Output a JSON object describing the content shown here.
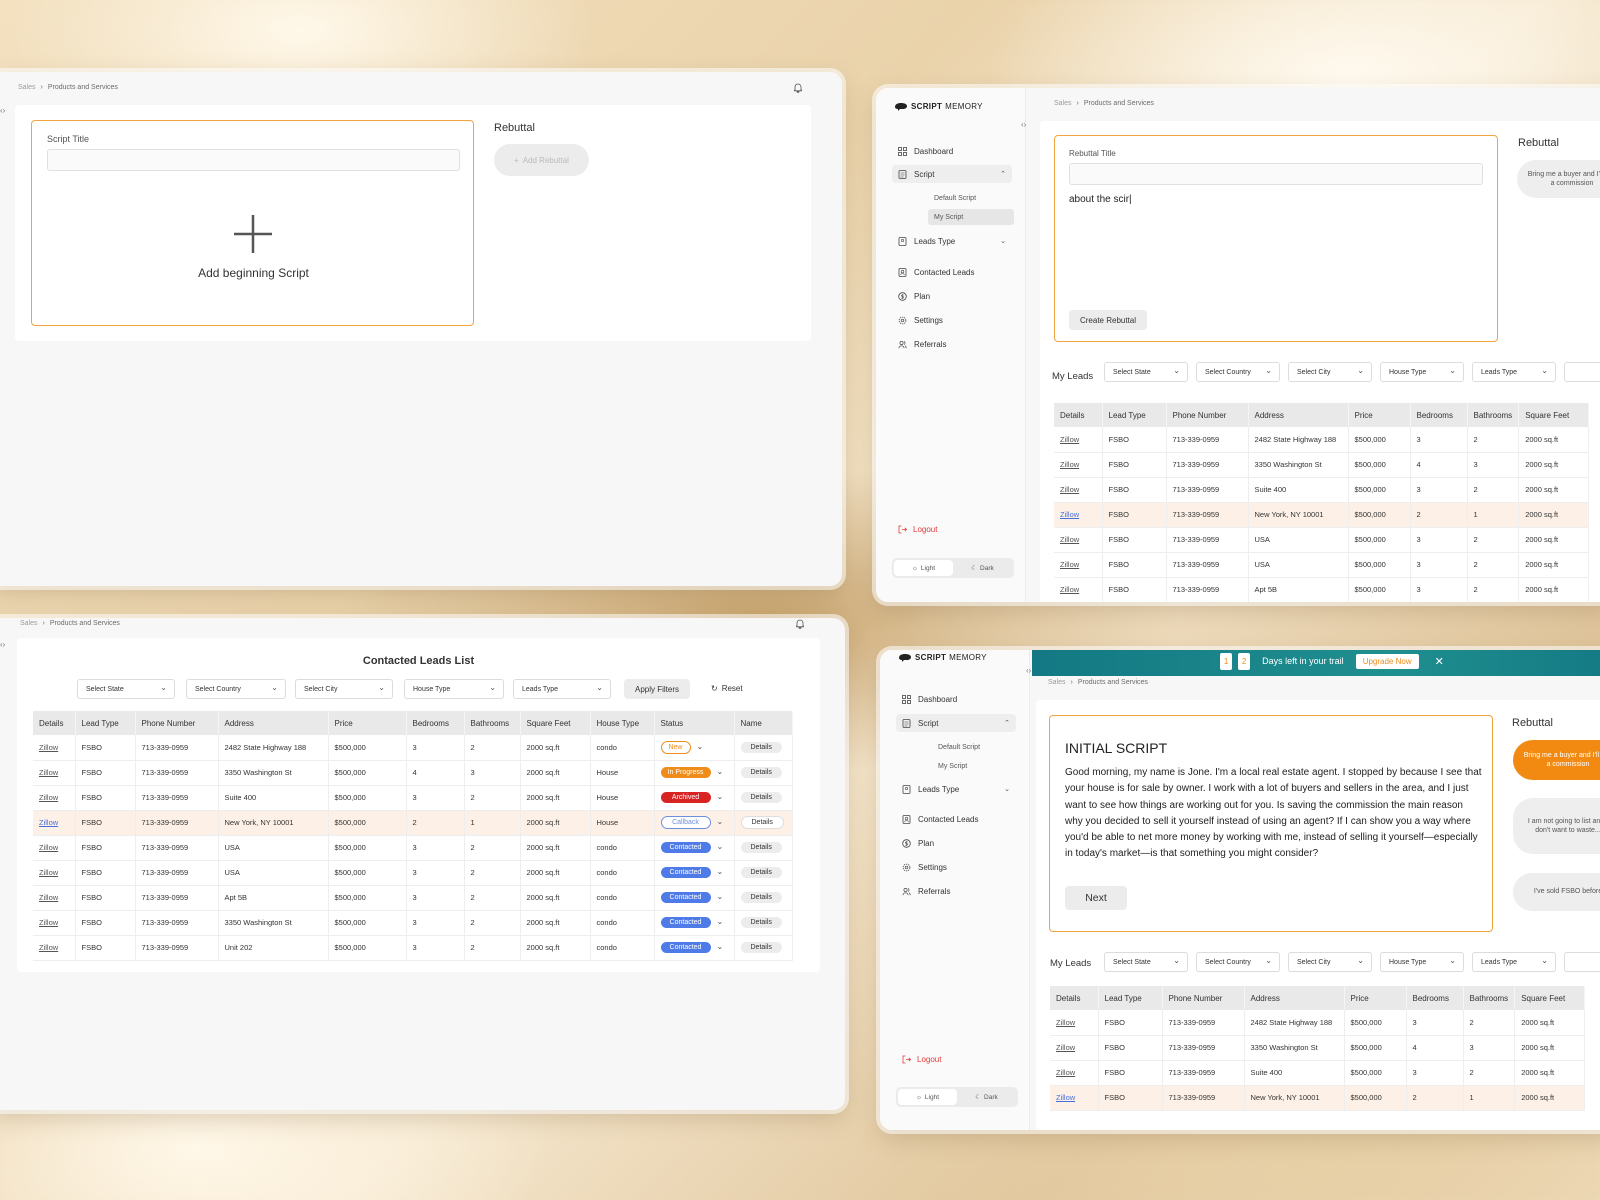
{
  "common": {
    "breadcrumb_root": "Sales",
    "breadcrumb_leaf": "Products and Services",
    "logo_bold": "SCRIPT",
    "logo_light": "MEMORY",
    "rebuttal_heading": "Rebuttal",
    "nav": {
      "dashboard": "Dashboard",
      "script": "Script",
      "default_script": "Default Script",
      "my_script": "My Script",
      "leads_type": "Leads Type",
      "contacted_leads": "Contacted Leads",
      "plan": "Plan",
      "settings": "Settings",
      "referrals": "Referrals",
      "logout": "Logout"
    },
    "theme_light": "Light",
    "theme_dark": "Dark",
    "filters": {
      "state": "Select State",
      "country": "Select Country",
      "city": "Select City",
      "house": "House Type",
      "leads": "Leads Type"
    },
    "my_leads": "My Leads"
  },
  "window1": {
    "script_title_label": "Script Title",
    "script_title_value": "",
    "add_rebuttal": "Add Rebuttal",
    "add_beginning": "Add beginning Script"
  },
  "window2": {
    "rebuttal_title_label": "Rebuttal Title",
    "rebuttal_title_value": "",
    "rebuttal_body": "about  the scir|",
    "create_rebuttal": "Create Rebuttal",
    "bubble1": "Bring me a buyer and I'll pay a commission",
    "columns": [
      "Details",
      "Lead Type",
      "Phone Number",
      "Address",
      "Price",
      "Bedrooms",
      "Bathrooms",
      "Square Feet"
    ],
    "rows": [
      [
        "Zillow",
        "FSBO",
        "713-339-0959",
        "2482 State Highway 188",
        "$500,000",
        "3",
        "2",
        "2000 sq.ft"
      ],
      [
        "Zillow",
        "FSBO",
        "713-339-0959",
        "3350 Washington St",
        "$500,000",
        "4",
        "3",
        "2000 sq.ft"
      ],
      [
        "Zillow",
        "FSBO",
        "713-339-0959",
        "Suite 400",
        "$500,000",
        "3",
        "2",
        "2000 sq.ft"
      ],
      [
        "Zillow",
        "FSBO",
        "713-339-0959",
        "New York, NY 10001",
        "$500,000",
        "2",
        "1",
        "2000 sq.ft"
      ],
      [
        "Zillow",
        "FSBO",
        "713-339-0959",
        "USA",
        "$500,000",
        "3",
        "2",
        "2000 sq.ft"
      ],
      [
        "Zillow",
        "FSBO",
        "713-339-0959",
        "USA",
        "$500,000",
        "3",
        "2",
        "2000 sq.ft"
      ],
      [
        "Zillow",
        "FSBO",
        "713-339-0959",
        "Apt 5B",
        "$500,000",
        "3",
        "2",
        "2000 sq.ft"
      ]
    ]
  },
  "window3": {
    "title": "Contacted Leads List",
    "apply_filters": "Apply Filters",
    "reset": "Reset",
    "columns": [
      "Details",
      "Lead Type",
      "Phone Number",
      "Address",
      "Price",
      "Bedrooms",
      "Bathrooms",
      "Square Feet",
      "House Type",
      "Status",
      "Name"
    ],
    "rows": [
      [
        "Zillow",
        "FSBO",
        "713-339-0959",
        "2482 State Highway 188",
        "$500,000",
        "3",
        "2",
        "2000 sq.ft",
        "condo",
        "New",
        "Details"
      ],
      [
        "Zillow",
        "FSBO",
        "713-339-0959",
        "3350 Washington St",
        "$500,000",
        "4",
        "3",
        "2000 sq.ft",
        "House",
        "In Progress",
        "Details"
      ],
      [
        "Zillow",
        "FSBO",
        "713-339-0959",
        "Suite 400",
        "$500,000",
        "3",
        "2",
        "2000 sq.ft",
        "House",
        "Archived",
        "Details"
      ],
      [
        "Zillow",
        "FSBO",
        "713-339-0959",
        "New York, NY 10001",
        "$500,000",
        "2",
        "1",
        "2000 sq.ft",
        "House",
        "Callback",
        "Details"
      ],
      [
        "Zillow",
        "FSBO",
        "713-339-0959",
        "USA",
        "$500,000",
        "3",
        "2",
        "2000 sq.ft",
        "condo",
        "Contacted",
        "Details"
      ],
      [
        "Zillow",
        "FSBO",
        "713-339-0959",
        "USA",
        "$500,000",
        "3",
        "2",
        "2000 sq.ft",
        "condo",
        "Contacted",
        "Details"
      ],
      [
        "Zillow",
        "FSBO",
        "713-339-0959",
        "Apt 5B",
        "$500,000",
        "3",
        "2",
        "2000 sq.ft",
        "condo",
        "Contacted",
        "Details"
      ],
      [
        "Zillow",
        "FSBO",
        "713-339-0959",
        "3350 Washington St",
        "$500,000",
        "3",
        "2",
        "2000 sq.ft",
        "condo",
        "Contacted",
        "Details"
      ],
      [
        "Zillow",
        "FSBO",
        "713-339-0959",
        "Unit 202",
        "$500,000",
        "3",
        "2",
        "2000 sq.ft",
        "condo",
        "Contacted",
        "Details"
      ]
    ],
    "status_colors": {
      "New": "#f08c1a",
      "In Progress": "#f08c1a",
      "Archived": "#d92424",
      "Callback": "#6c8fe0",
      "Contacted": "#4f7be8"
    }
  },
  "window4": {
    "days": [
      "1",
      "2"
    ],
    "days_text": "Days left in your trail",
    "upgrade": "Upgrade Now",
    "script_heading": "INITIAL SCRIPT",
    "script_body": "Good morning, my name is Jone. I'm a local real estate agent. I stopped by because I see that your house is for sale by owner. I work with a lot of buyers and sellers in the area, and I just want to see how things are working out for you. Is saving the commission the main reason why you decided to sell it yourself instead of using an agent? If I can show you a way where you'd be able to net more money by working with me, instead of selling it yourself—especially in today's market—is that something you might consider?",
    "next": "Next",
    "bubble1": "Bring me a buyer and I'll pay a commission",
    "bubble2": "I am not going to list and I don't want to waste...",
    "bubble3": "I've sold FSBO before",
    "columns": [
      "Details",
      "Lead Type",
      "Phone Number",
      "Address",
      "Price",
      "Bedrooms",
      "Bathrooms",
      "Square Feet"
    ],
    "rows": [
      [
        "Zillow",
        "FSBO",
        "713-339-0959",
        "2482 State Highway 188",
        "$500,000",
        "3",
        "2",
        "2000 sq.ft"
      ],
      [
        "Zillow",
        "FSBO",
        "713-339-0959",
        "3350 Washington St",
        "$500,000",
        "4",
        "3",
        "2000 sq.ft"
      ],
      [
        "Zillow",
        "FSBO",
        "713-339-0959",
        "Suite 400",
        "$500,000",
        "3",
        "2",
        "2000 sq.ft"
      ],
      [
        "Zillow",
        "FSBO",
        "713-339-0959",
        "New York, NY 10001",
        "$500,000",
        "2",
        "1",
        "2000 sq.ft"
      ]
    ]
  }
}
